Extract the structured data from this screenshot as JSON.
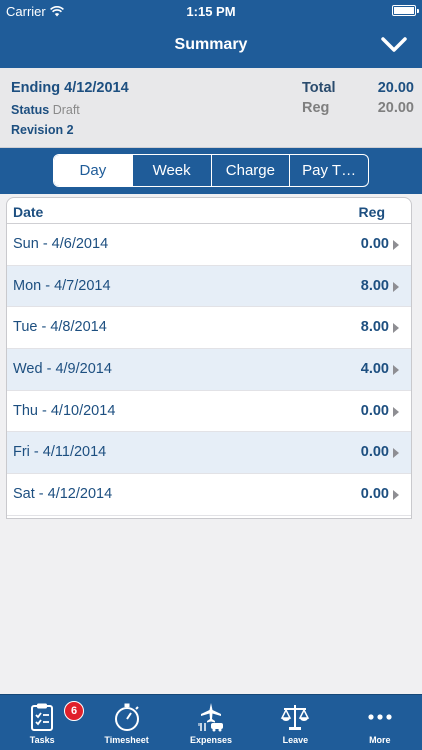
{
  "status_bar": {
    "carrier": "Carrier",
    "time": "1:15 PM"
  },
  "nav": {
    "title": "Summary"
  },
  "summary": {
    "ending": "Ending 4/12/2014",
    "status_label": "Status",
    "status_value": "Draft",
    "revision": "Revision 2",
    "total_label": "Total",
    "total_value": "20.00",
    "reg_label": "Reg",
    "reg_value": "20.00"
  },
  "segments": [
    "Day",
    "Week",
    "Charge",
    "Pay T…"
  ],
  "table": {
    "header_date": "Date",
    "header_reg": "Reg",
    "rows": [
      {
        "date": "Sun - 4/6/2014",
        "reg": "0.00"
      },
      {
        "date": "Mon - 4/7/2014",
        "reg": "8.00"
      },
      {
        "date": "Tue - 4/8/2014",
        "reg": "8.00"
      },
      {
        "date": "Wed - 4/9/2014",
        "reg": "4.00"
      },
      {
        "date": "Thu - 4/10/2014",
        "reg": "0.00"
      },
      {
        "date": "Fri - 4/11/2014",
        "reg": "0.00"
      },
      {
        "date": "Sat - 4/12/2014",
        "reg": "0.00"
      }
    ]
  },
  "tabs": [
    {
      "label": "Tasks",
      "icon": "clipboard-icon",
      "badge": "6"
    },
    {
      "label": "Timesheet",
      "icon": "stopwatch-icon"
    },
    {
      "label": "Expenses",
      "icon": "travel-icon"
    },
    {
      "label": "Leave",
      "icon": "scales-icon"
    },
    {
      "label": "More",
      "icon": "more-dots-icon"
    }
  ]
}
